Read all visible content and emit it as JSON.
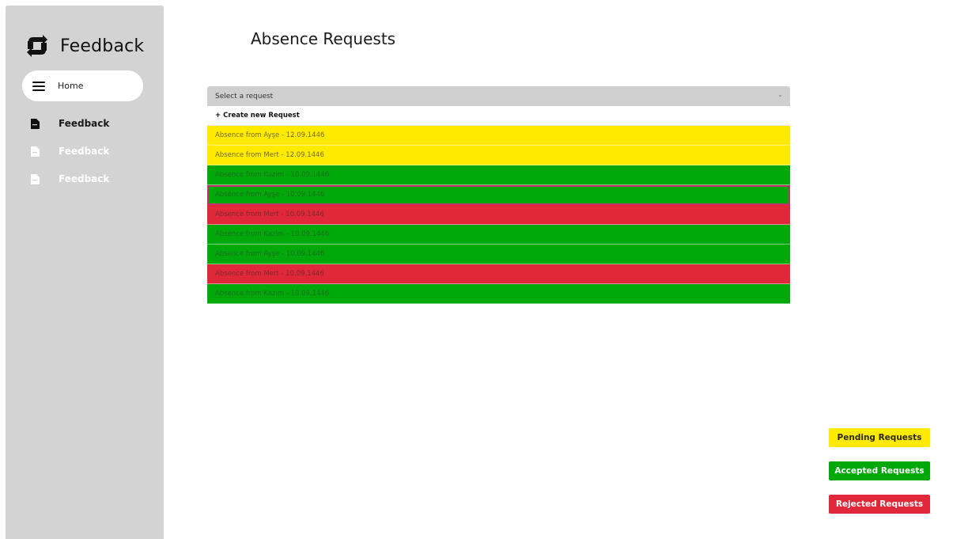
{
  "app": {
    "brand": "Feedback"
  },
  "sidebar": {
    "home_label": "Home",
    "items": [
      {
        "label": "Feedback",
        "style": "dark"
      },
      {
        "label": "Feedback",
        "style": "light"
      },
      {
        "label": "Feedback",
        "style": "light"
      }
    ]
  },
  "main": {
    "title": "Absence Requests",
    "select": {
      "placeholder": "Select a request",
      "create_label": "+ Create new Request",
      "options": [
        {
          "label": "Absence from Ayşe - 12.09.1446",
          "status": "pending"
        },
        {
          "label": "Absence from Mert - 12.09.1446",
          "status": "pending"
        },
        {
          "label": "Absence from Kazim - 10.09.1446",
          "status": "accepted"
        },
        {
          "label": "Absence from Ayşe - 10.09.1446",
          "status": "accepted"
        },
        {
          "label": "Absence from Mert - 10.09.1446",
          "status": "rejected"
        },
        {
          "label": "Absence from Kazim - 10.09.1446",
          "status": "accepted"
        },
        {
          "label": "Absence from Ayşe - 10.09.1446",
          "status": "accepted"
        },
        {
          "label": "Absence from Mert - 10.09.1446",
          "status": "rejected"
        },
        {
          "label": "Absence from Kazim - 10.09.1446",
          "status": "accepted"
        }
      ]
    }
  },
  "legend": {
    "pending_label": "Pending Requests",
    "accepted_label": "Accepted Requests",
    "rejected_label": "Rejected Requests"
  },
  "colors": {
    "pending": "#ffea00",
    "accepted": "#00a80a",
    "rejected": "#e0283a",
    "sidebar": "#d3d3d3"
  }
}
